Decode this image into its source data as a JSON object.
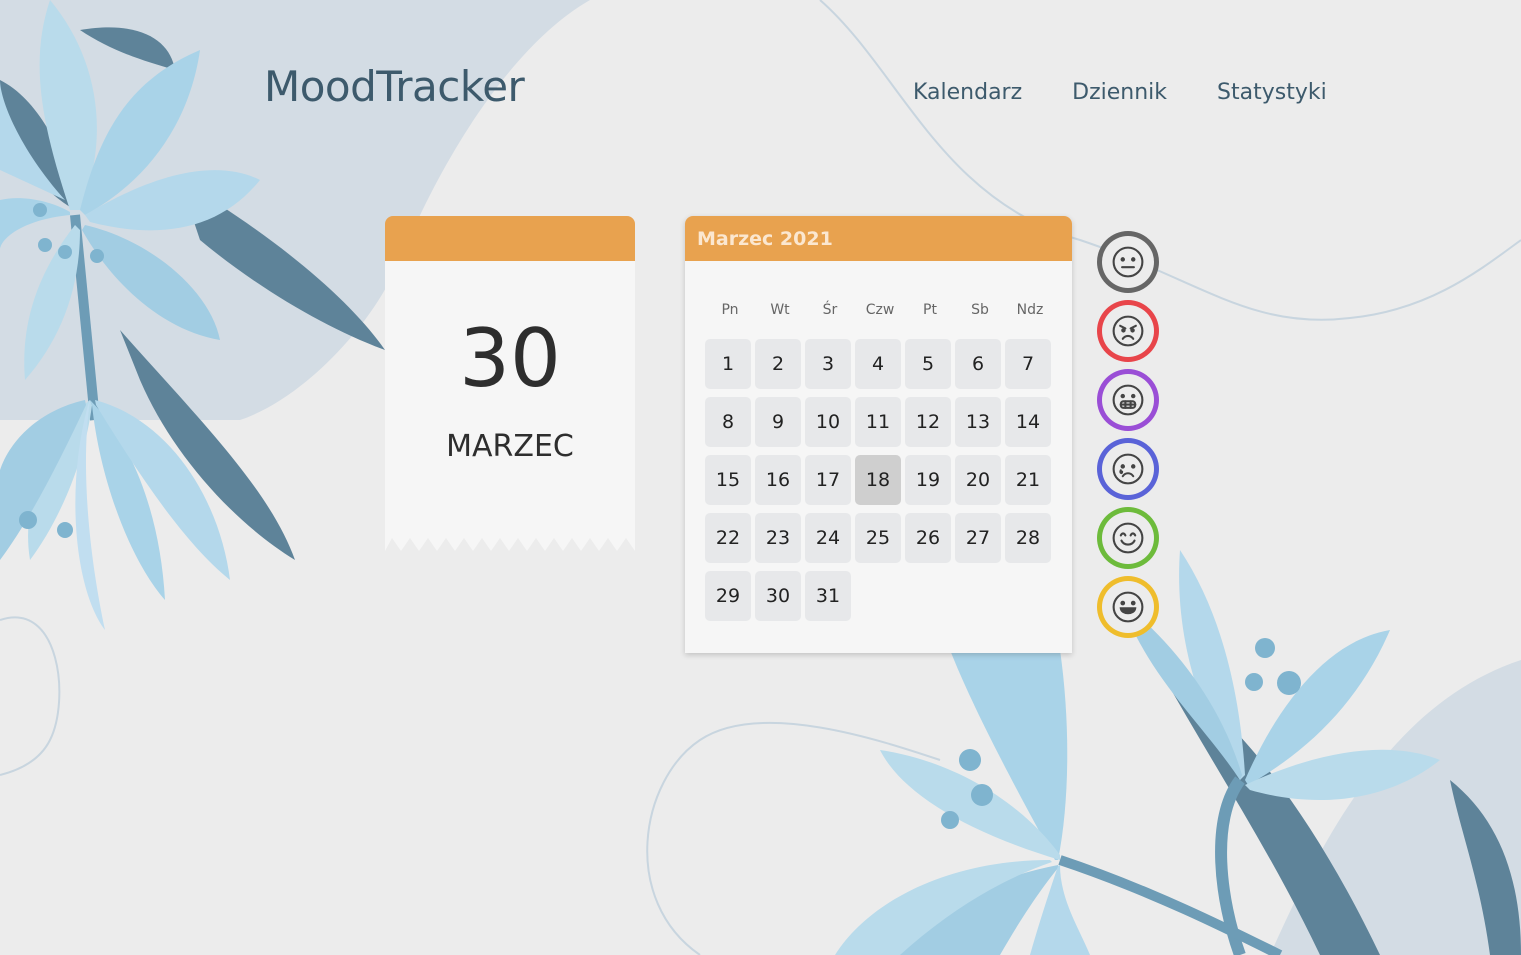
{
  "app": {
    "logo": "MoodTracker"
  },
  "nav": [
    {
      "label": "Kalendarz"
    },
    {
      "label": "Dziennik"
    },
    {
      "label": "Statystyki"
    }
  ],
  "today": {
    "day": "30",
    "month": "MARZEC"
  },
  "calendar": {
    "title": "Marzec 2021",
    "weekdays": [
      "Pn",
      "Wt",
      "Śr",
      "Czw",
      "Pt",
      "Sb",
      "Ndz"
    ],
    "days": [
      "1",
      "2",
      "3",
      "4",
      "5",
      "6",
      "7",
      "8",
      "9",
      "10",
      "11",
      "12",
      "13",
      "14",
      "15",
      "16",
      "17",
      "18",
      "19",
      "20",
      "21",
      "22",
      "23",
      "24",
      "25",
      "26",
      "27",
      "28",
      "29",
      "30",
      "31"
    ],
    "selected_day": "18"
  },
  "moods": [
    {
      "name": "neutral-mood-icon",
      "color": "#666666"
    },
    {
      "name": "angry-mood-icon",
      "color": "#e8454a"
    },
    {
      "name": "grimace-mood-icon",
      "color": "#9a4ed6"
    },
    {
      "name": "sad-mood-icon",
      "color": "#5a63d8"
    },
    {
      "name": "content-mood-icon",
      "color": "#6dbb3b"
    },
    {
      "name": "happy-mood-icon",
      "color": "#efbd2c"
    }
  ],
  "colors": {
    "accent": "#e8a24f",
    "title": "#3d5a6c"
  }
}
